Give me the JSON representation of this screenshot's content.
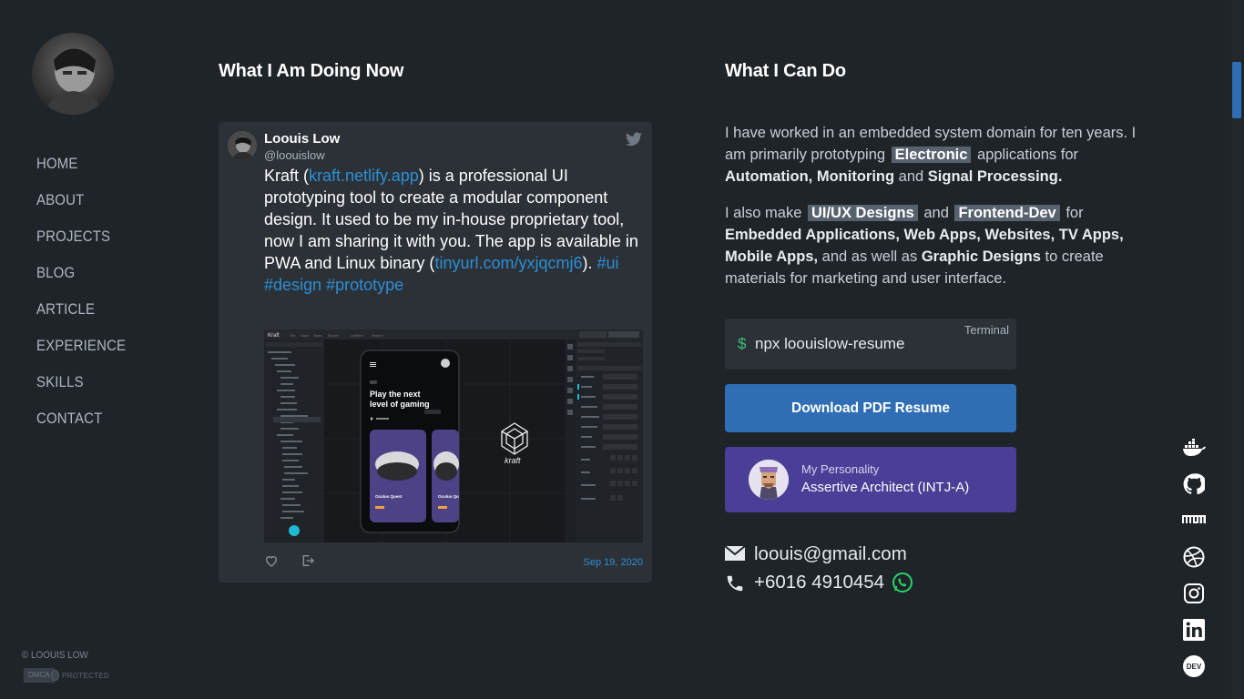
{
  "sidebar": {
    "nav": [
      "HOME",
      "ABOUT",
      "PROJECTS",
      "BLOG",
      "ARTICLE",
      "EXPERIENCE",
      "SKILLS",
      "CONTACT"
    ],
    "copyright": "© LOOUIS LOW",
    "dmca_left": "DMCA",
    "dmca_right": "PROTECTED"
  },
  "doing_now": {
    "title": "What I Am Doing Now",
    "tweet": {
      "name": "Loouis Low",
      "handle": "@loouislow",
      "text_1": "Kraft (",
      "link_1": "kraft.netlify.app",
      "text_2": ") is a professional UI prototyping tool to create a modular component design. It used to be my in-house proprietary tool, now I am sharing it with you. The app is available in PWA and Linux binary (",
      "link_2": "tinyurl.com/yxjqcmj6",
      "text_3": "). ",
      "tag_1": "#ui",
      "tag_2": "#design",
      "tag_3": "#prototype",
      "date": "Sep 19, 2020",
      "media": {
        "logo": "Kraft",
        "brand": "kraft",
        "phone_title_1": "Play the next",
        "phone_title_2": "level of gaming",
        "card_1": "Oculus Quest",
        "card_2": "Oculus Qu"
      }
    }
  },
  "can_do": {
    "title": "What I Can Do",
    "p1_a": "I have worked in an embedded system domain for ten years. I am primarily prototyping",
    "p1_hl": "Electronic",
    "p1_b": "applications for",
    "p1_s1": "Automation,",
    "p1_s2": "Monitoring",
    "p1_and": "and",
    "p1_s3": "Signal Processing.",
    "p2_a": "I also make",
    "p2_hl1": "UI/UX Designs",
    "p2_and": "and",
    "p2_hl2": "Frontend-Dev",
    "p2_for": "for",
    "p2_s1": "Embedded Applications,",
    "p2_s2": "Web Apps,",
    "p2_s3": "Websites,",
    "p2_s4": "TV Apps,",
    "p2_s5": "Mobile Apps,",
    "p2_b": "and as well as",
    "p2_s6": "Graphic Designs",
    "p2_c": "to create materials for marketing and user interface.",
    "terminal": {
      "label": "Terminal",
      "prompt": "$",
      "command": "npx loouislow-resume"
    },
    "download_label": "Download PDF Resume",
    "personality": {
      "line1": "My Personality",
      "line2": "Assertive Architect (INTJ-A)"
    },
    "email": "loouis@gmail.com",
    "phone": "+6016 4910454"
  },
  "social_icons": [
    "docker-icon",
    "github-icon",
    "npm-icon",
    "dribbble-icon",
    "instagram-icon",
    "linkedin-icon",
    "dev-icon"
  ],
  "colors": {
    "background": "#1f2429",
    "card": "#2c3137",
    "accent_blue": "#2f6db5",
    "link": "#2b8fd6",
    "personality": "#4a3f96",
    "terminal_prompt": "#3cc07a",
    "whatsapp": "#25d366"
  }
}
